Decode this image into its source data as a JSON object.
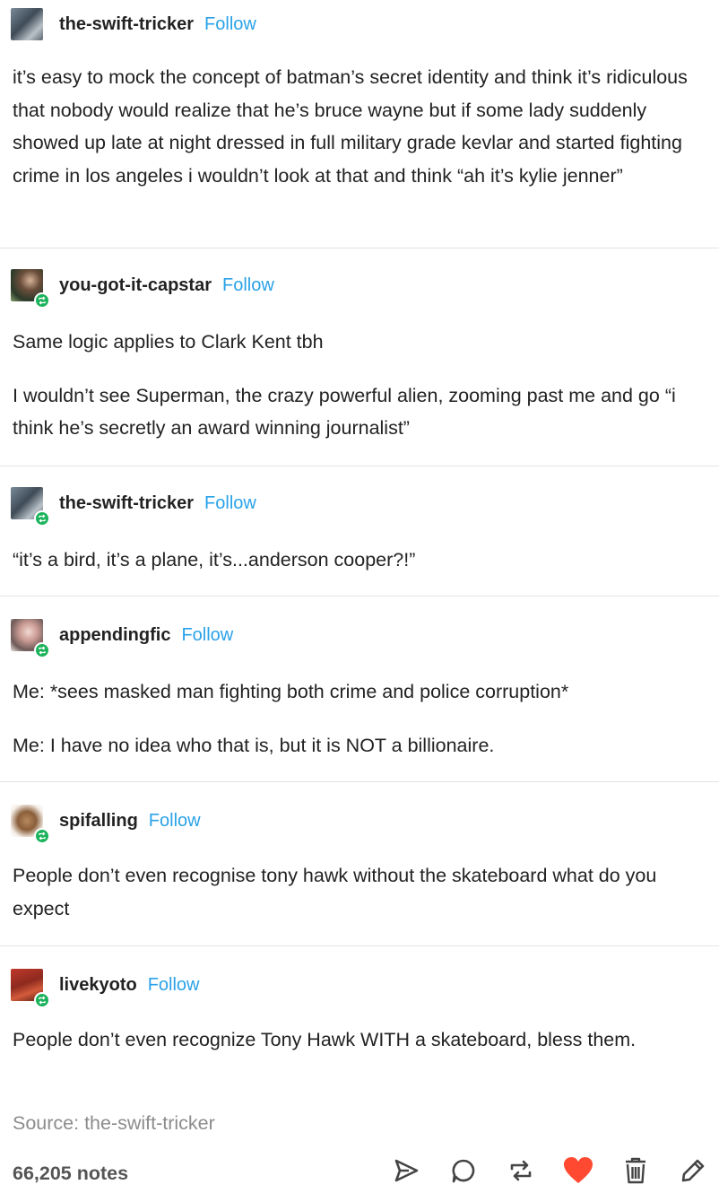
{
  "reblogs": [
    {
      "username": "the-swift-tricker",
      "follow_label": "Follow",
      "paragraphs": [
        "it’s easy to mock the concept of batman’s secret identity and think it’s ridiculous that nobody would realize that he’s bruce wayne but if some lady suddenly showed up late at night dressed in full military grade kevlar and started fighting crime in los angeles i wouldn’t look at that and think “ah it’s kylie jenner”"
      ]
    },
    {
      "username": "you-got-it-capstar",
      "follow_label": "Follow",
      "paragraphs": [
        "Same logic applies to Clark Kent tbh",
        "I wouldn’t see Superman, the crazy powerful alien, zooming past me and go “i think he’s secretly an award winning journalist”"
      ]
    },
    {
      "username": "the-swift-tricker",
      "follow_label": "Follow",
      "paragraphs": [
        "“it’s a bird, it’s a plane, it’s...anderson cooper?!”"
      ]
    },
    {
      "username": "appendingfic",
      "follow_label": "Follow",
      "paragraphs": [
        "Me: *sees masked man fighting both crime and police corruption*",
        "Me: I have no idea who that is, but it is NOT a billionaire."
      ]
    },
    {
      "username": "spifalling",
      "follow_label": "Follow",
      "paragraphs": [
        "People don’t even recognise tony hawk without the skateboard what do you expect"
      ]
    },
    {
      "username": "livekyoto",
      "follow_label": "Follow",
      "paragraphs": [
        "People don’t even recognize Tony Hawk WITH a skateboard, bless them."
      ]
    }
  ],
  "footer": {
    "source": "Source: the-swift-tricker",
    "notes": "66,205 notes",
    "actions": [
      "share-icon",
      "reply-icon",
      "reblog-icon",
      "like-icon",
      "delete-icon",
      "edit-icon"
    ]
  },
  "colors": {
    "follow": "#2aa2e8",
    "reblog_badge": "#1bb35b",
    "like": "#ff4930",
    "icons": "#444444",
    "muted": "#8c8c8c"
  }
}
